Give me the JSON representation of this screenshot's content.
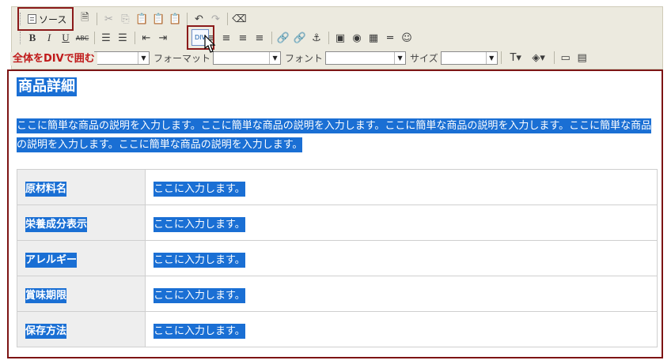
{
  "toolbar": {
    "source_label": "ソース",
    "font_format_label": "フォーマット",
    "font_label": "フォント",
    "size_label": "サイズ",
    "style_value": "",
    "format_value": "",
    "font_value": "",
    "size_value": ""
  },
  "annotation": {
    "wrap_div_note": "全体をDIVで囲む"
  },
  "content": {
    "title": "商品詳細",
    "description": "ここに簡単な商品の説明を入力します。ここに簡単な商品の説明を入力します。ここに簡単な商品の説明を入力します。ここに簡単な商品の説明を入力します。ここに簡単な商品の説明を入力します。",
    "rows": [
      {
        "label": "原材料名",
        "value": "ここに入力します。"
      },
      {
        "label": "栄養成分表示",
        "value": "ここに入力します。"
      },
      {
        "label": "アレルギー",
        "value": "ここに入力します。"
      },
      {
        "label": "賞味期限",
        "value": "ここに入力します。"
      },
      {
        "label": "保存方法",
        "value": "ここに入力します。"
      }
    ]
  },
  "colors": {
    "selection": "#1a6fd4",
    "highlight_box": "#8b1a1a",
    "toolbar_bg": "#eceadf",
    "note_text": "#c01a1a"
  }
}
